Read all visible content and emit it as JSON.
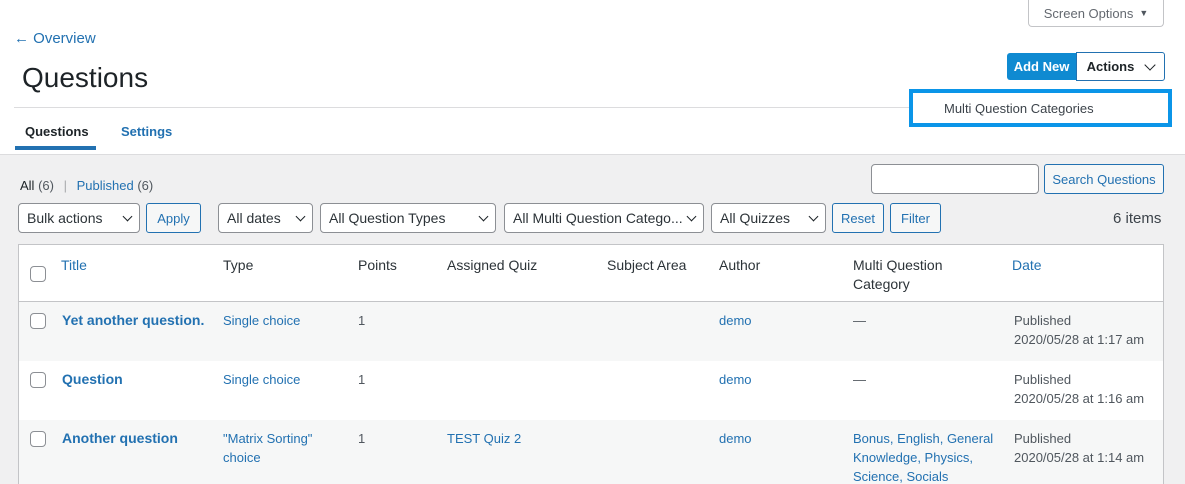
{
  "screen_options": {
    "label": "Screen Options"
  },
  "header": {
    "back_link": "← Overview",
    "title": "Questions",
    "add_new": "Add New",
    "actions": "Actions",
    "dropdown_item": "Multi Question Categories"
  },
  "tabs": [
    {
      "label": "Questions",
      "active": true
    },
    {
      "label": "Settings",
      "active": false
    }
  ],
  "filters_links": {
    "all": "All",
    "all_count": "(6)",
    "sep": "|",
    "published": "Published",
    "published_count": "(6)"
  },
  "search": {
    "value": "",
    "button": "Search Questions"
  },
  "toolbar": {
    "bulk_actions": "Bulk actions",
    "apply": "Apply",
    "dates": "All dates",
    "types": "All Question Types",
    "categories": "All Multi Question Catego...",
    "quizzes": "All Quizzes",
    "reset": "Reset",
    "filter": "Filter",
    "items_count": "6 items"
  },
  "table": {
    "columns": {
      "title": "Title",
      "type": "Type",
      "points": "Points",
      "assigned_quiz": "Assigned Quiz",
      "subject_area": "Subject Area",
      "author": "Author",
      "category_line1": "Multi Question",
      "category_line2": "Category",
      "date": "Date"
    },
    "rows": [
      {
        "title": "Yet another question.",
        "type1": "Single choice",
        "type2": "",
        "points": "1",
        "quiz": "",
        "author": "demo",
        "cat1": "—",
        "cat2": "",
        "cat3": "",
        "status": "Published",
        "date": "2020/05/28 at 1:17 am"
      },
      {
        "title": "Question",
        "type1": "Single choice",
        "type2": "",
        "points": "1",
        "quiz": "",
        "author": "demo",
        "cat1": "—",
        "cat2": "",
        "cat3": "",
        "status": "Published",
        "date": "2020/05/28 at 1:16 am"
      },
      {
        "title": "Another question",
        "type1": "\"Matrix Sorting\"",
        "type2": "choice",
        "points": "1",
        "quiz": "TEST Quiz 2",
        "author": "demo",
        "cat1": "Bonus, English, General",
        "cat2": "Knowledge, Physics,",
        "cat3": "Science, Socials",
        "status": "Published",
        "date": "2020/05/28 at 1:14 am"
      }
    ]
  },
  "colors": {
    "primary": "#2271b1",
    "add_new_bg": "#0f8ad1",
    "dropdown_border": "#0b95e8"
  }
}
